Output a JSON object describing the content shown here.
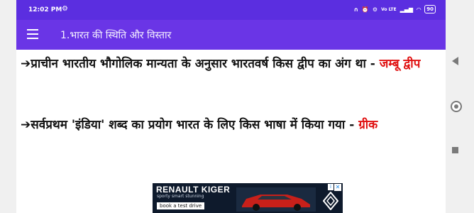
{
  "status_bar": {
    "time": "12:02 PM",
    "gear_icon": "gear-icon",
    "right_icons": [
      "headset-icon",
      "alarm-icon",
      "wifi-icon",
      "signal-icon"
    ],
    "signal_text": "Vo LTE",
    "battery": "90"
  },
  "app_bar": {
    "title": "1.भारत की स्थिति और विस्तार",
    "menu_icon": "hamburger-menu-icon"
  },
  "content": {
    "items": [
      {
        "arrow": "➔",
        "question": "प्राचीन भारतीय भौगोलिक मान्यता के अनुसार भारतवर्ष किस द्वीप का अंग था - ",
        "answer": "जम्बू द्वीप"
      },
      {
        "arrow": "➔",
        "question": "सर्वप्रथम 'इंडिया' शब्द का प्रयोग भारत के लिए किस भाषा में किया गया - ",
        "answer": "ग्रीक"
      }
    ]
  },
  "ad": {
    "brand": "RENAULT KIGER",
    "tagline": "sporty smart stunning",
    "button": "book a test drive",
    "close": "✕",
    "info": "i"
  },
  "colors": {
    "status_bar": "#5b2ee0",
    "app_bar": "#6a35e6",
    "answer": "#e01010"
  }
}
